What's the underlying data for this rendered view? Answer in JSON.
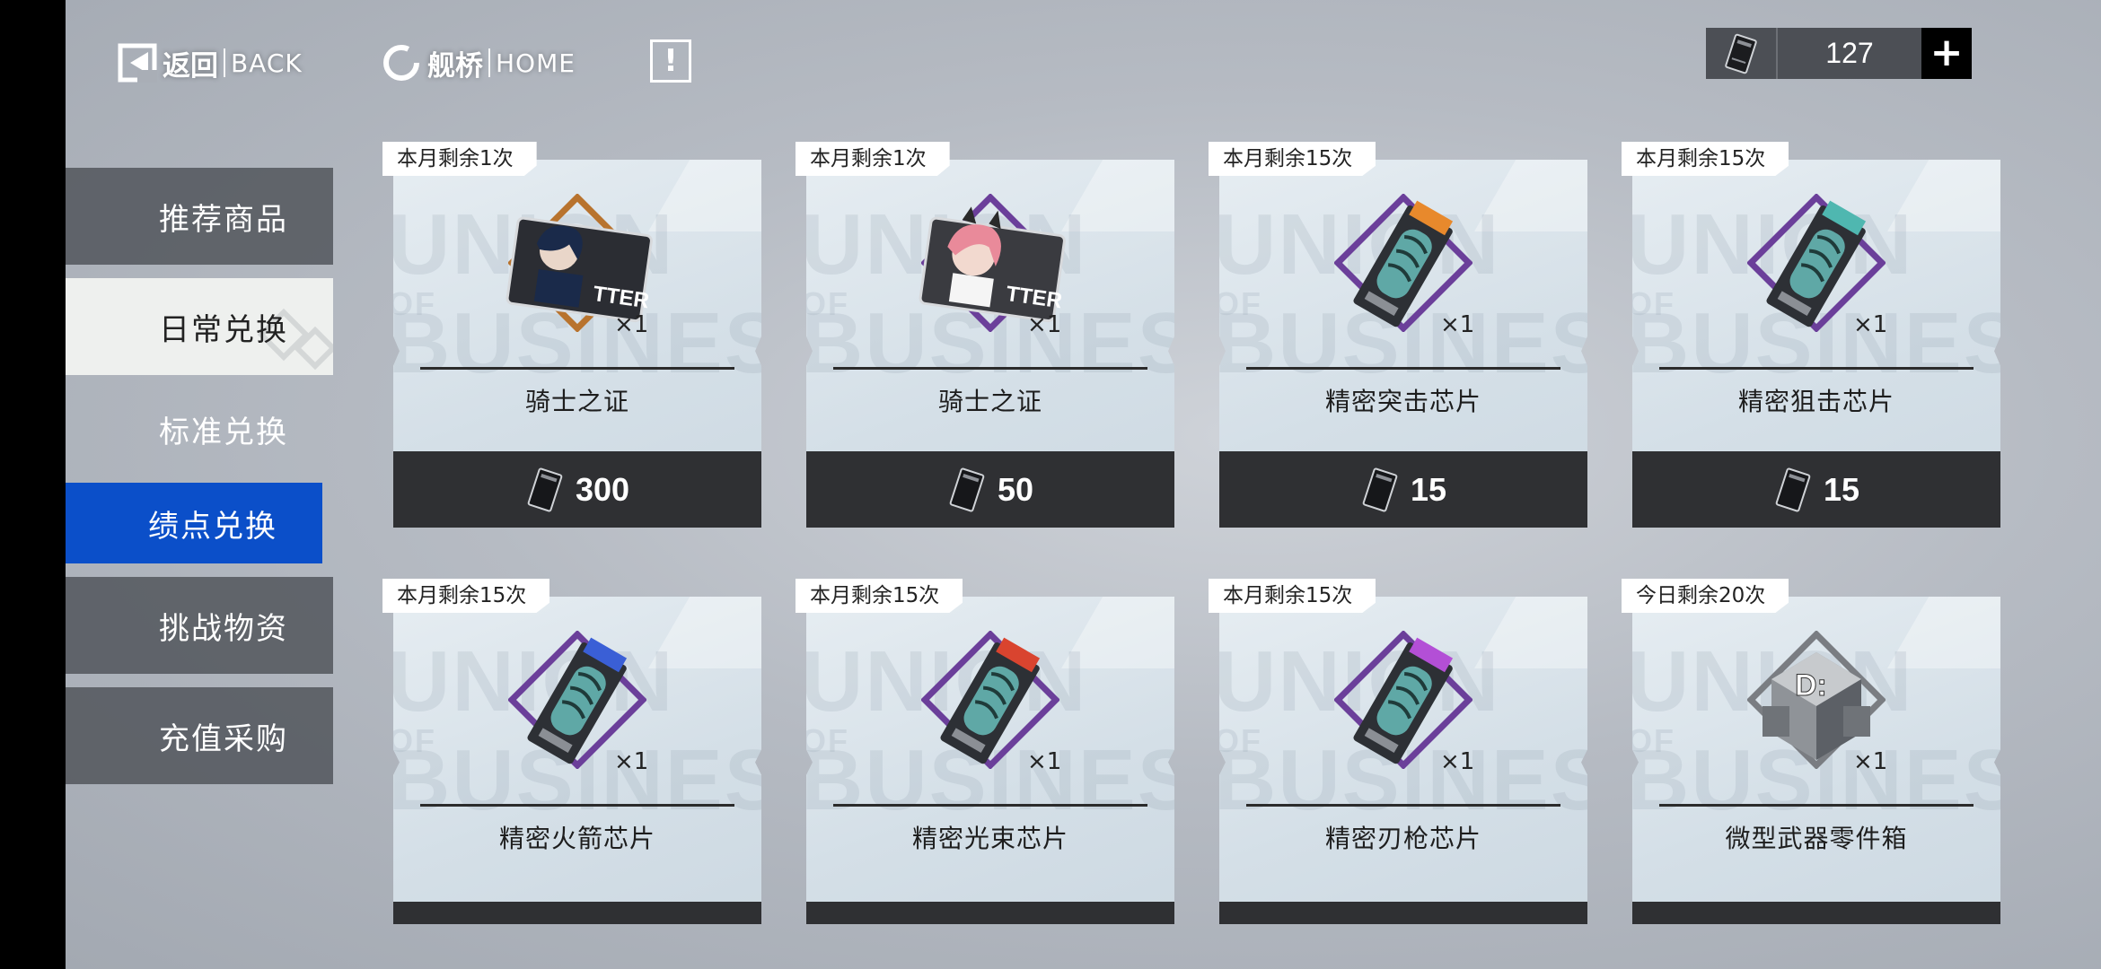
{
  "nav": {
    "back_label": "返回",
    "back_en": "BACK",
    "home_label": "舰桥",
    "home_en": "HOME",
    "alert_symbol": "!"
  },
  "currency": {
    "amount": "127",
    "plus": "+"
  },
  "sidebar": {
    "items": [
      {
        "label": "推荐商品",
        "state": "default"
      },
      {
        "label": "日常兑换",
        "state": "highlighted"
      },
      {
        "label": "标准兑换",
        "state": "default"
      },
      {
        "label": "绩点兑换",
        "state": "selected"
      },
      {
        "label": "挑战物资",
        "state": "default"
      },
      {
        "label": "充值采购",
        "state": "default"
      }
    ]
  },
  "watermark": {
    "line1": "UNION",
    "line2": "OF",
    "line3": "BUSINESS"
  },
  "cards": [
    {
      "limit": "本月剩余1次",
      "name": "骑士之证",
      "qty": "×1",
      "price": "300",
      "item": "knight-card-black-hair",
      "frame_color": "#b8732e"
    },
    {
      "limit": "本月剩余1次",
      "name": "骑士之证",
      "qty": "×1",
      "price": "50",
      "item": "knight-card-pink-hair",
      "frame_color": "#6b3f9a"
    },
    {
      "limit": "本月剩余15次",
      "name": "精密突击芯片",
      "qty": "×1",
      "price": "15",
      "item": "chip-orange",
      "frame_color": "#6b3f9a"
    },
    {
      "limit": "本月剩余15次",
      "name": "精密狙击芯片",
      "qty": "×1",
      "price": "15",
      "item": "chip-teal",
      "frame_color": "#6b3f9a"
    },
    {
      "limit": "本月剩余15次",
      "name": "精密火箭芯片",
      "qty": "×1",
      "item": "chip-blue",
      "frame_color": "#6b3f9a"
    },
    {
      "limit": "本月剩余15次",
      "name": "精密光束芯片",
      "qty": "×1",
      "item": "chip-red",
      "frame_color": "#6b3f9a"
    },
    {
      "limit": "本月剩余15次",
      "name": "精密刃枪芯片",
      "qty": "×1",
      "item": "chip-purple",
      "frame_color": "#6b3f9a"
    },
    {
      "limit": "今日剩余20次",
      "name": "微型武器零件箱",
      "qty": "×1",
      "item": "weapon-parts-box",
      "frame_color": "#7a7d82"
    }
  ],
  "colors": {
    "accent_blue": "#0b4fc9",
    "price_bar": "#2f3033",
    "chip_orange": "#e8892c",
    "chip_teal": "#4fb7b0",
    "chip_blue": "#3a5fd6",
    "chip_red": "#d9442f",
    "chip_purple": "#b34fd6"
  }
}
